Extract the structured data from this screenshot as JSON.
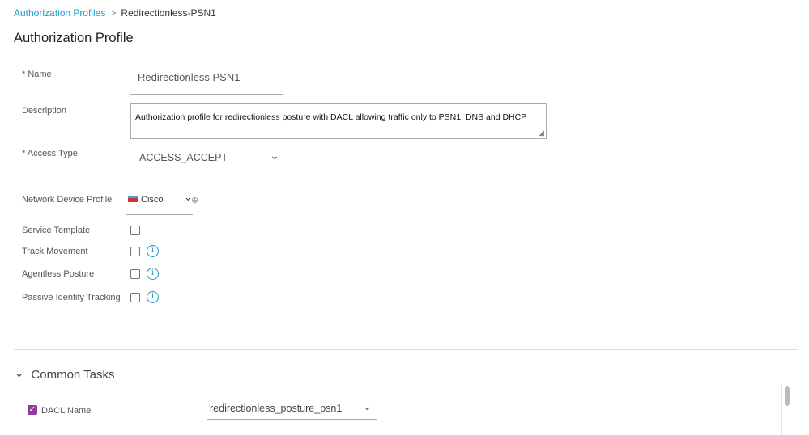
{
  "breadcrumb": {
    "parent": "Authorization Profiles",
    "separator": ">",
    "current": "Redirectionless-PSN1"
  },
  "page_title": "Authorization Profile",
  "form": {
    "name": {
      "label": "* Name",
      "value": "Redirectionless PSN1"
    },
    "description": {
      "label": "Description",
      "value": "Authorization profile for redirectionless posture with DACL allowing traffic only to PSN1, DNS and DHCP"
    },
    "access_type": {
      "label": "* Access Type",
      "value": "ACCESS_ACCEPT"
    },
    "network_device_profile": {
      "label": "Network Device Profile",
      "value": "Cisco"
    },
    "service_template": {
      "label": "Service Template",
      "checked": false
    },
    "track_movement": {
      "label": "Track Movement",
      "checked": false
    },
    "agentless_posture": {
      "label": "Agentless Posture",
      "checked": false
    },
    "passive_identity_tracking": {
      "label": "Passive Identity Tracking",
      "checked": false
    }
  },
  "common_tasks": {
    "title": "Common Tasks",
    "dacl": {
      "label": "DACL Name",
      "checked": true,
      "value": "redirectionless_posture_psn1"
    }
  },
  "colors": {
    "link": "#1e9cc6",
    "checkbox_checked": "#8e3d96"
  }
}
